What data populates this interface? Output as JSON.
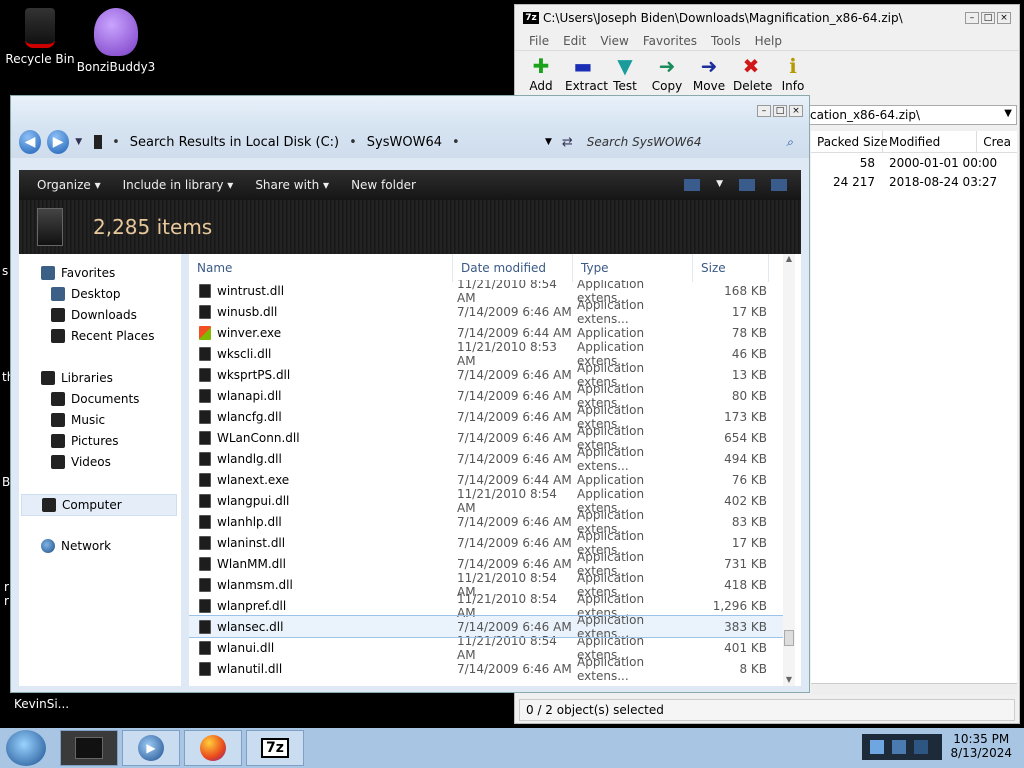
{
  "desktop": {
    "icons": [
      {
        "label": "Recycle Bin"
      },
      {
        "label": "BonziBuddy3"
      },
      {
        "label": "KevinSi..."
      }
    ],
    "edge_fragments": [
      "s",
      "th",
      "B",
      "r",
      "r"
    ]
  },
  "zip": {
    "title": "C:\\Users\\Joseph Biden\\Downloads\\Magnification_x86-64.zip\\",
    "logo": "7z",
    "menu": [
      "File",
      "Edit",
      "View",
      "Favorites",
      "Tools",
      "Help"
    ],
    "tools": [
      {
        "label": "Add",
        "icon": "add-icon",
        "color": "#1aa31a"
      },
      {
        "label": "Extract",
        "icon": "extract-icon",
        "color": "#1a2fb5"
      },
      {
        "label": "Test",
        "icon": "test-icon",
        "color": "#1a9c9c"
      },
      {
        "label": "Copy",
        "icon": "copy-icon",
        "color": "#1a8b5a"
      },
      {
        "label": "Move",
        "icon": "move-icon",
        "color": "#1a2f9c"
      },
      {
        "label": "Delete",
        "icon": "delete-icon",
        "color": "#d01818"
      },
      {
        "label": "Info",
        "icon": "info-icon",
        "color": "#b59b00"
      }
    ],
    "path": "cation_x86-64.zip\\",
    "columns": [
      "Packed Size",
      "Modified",
      "Crea"
    ],
    "rows": [
      {
        "packed": "58",
        "modified": "2000-01-01 00:00"
      },
      {
        "packed": "24 217",
        "modified": "2018-08-24 03:27"
      }
    ],
    "status": "0 / 2 object(s) selected"
  },
  "explorer": {
    "address": [
      "Search Results in Local Disk (C:)",
      "SysWOW64"
    ],
    "search_placeholder": "Search SysWOW64",
    "commands": [
      "Organize ▾",
      "Include in library ▾",
      "Share with ▾",
      "New folder"
    ],
    "item_count": "2,285 items",
    "nav": {
      "favorites": "Favorites",
      "desktop": "Desktop",
      "downloads": "Downloads",
      "recent": "Recent Places",
      "libraries": "Libraries",
      "documents": "Documents",
      "music": "Music",
      "pictures": "Pictures",
      "videos": "Videos",
      "computer": "Computer",
      "network": "Network"
    },
    "columns": {
      "name": "Name",
      "date": "Date modified",
      "type": "Type",
      "size": "Size"
    },
    "files": [
      {
        "name": "wintrust.dll",
        "date": "11/21/2010 8:54 AM",
        "type": "Application extens...",
        "size": "168 KB",
        "icon": "dll"
      },
      {
        "name": "winusb.dll",
        "date": "7/14/2009 6:46 AM",
        "type": "Application extens...",
        "size": "17 KB",
        "icon": "dll"
      },
      {
        "name": "winver.exe",
        "date": "7/14/2009 6:44 AM",
        "type": "Application",
        "size": "78 KB",
        "icon": "win"
      },
      {
        "name": "wkscli.dll",
        "date": "11/21/2010 8:53 AM",
        "type": "Application extens...",
        "size": "46 KB",
        "icon": "dll"
      },
      {
        "name": "wksprtPS.dll",
        "date": "7/14/2009 6:46 AM",
        "type": "Application extens...",
        "size": "13 KB",
        "icon": "dll"
      },
      {
        "name": "wlanapi.dll",
        "date": "7/14/2009 6:46 AM",
        "type": "Application extens...",
        "size": "80 KB",
        "icon": "dll"
      },
      {
        "name": "wlancfg.dll",
        "date": "7/14/2009 6:46 AM",
        "type": "Application extens...",
        "size": "173 KB",
        "icon": "dll"
      },
      {
        "name": "WLanConn.dll",
        "date": "7/14/2009 6:46 AM",
        "type": "Application extens...",
        "size": "654 KB",
        "icon": "dll"
      },
      {
        "name": "wlandlg.dll",
        "date": "7/14/2009 6:46 AM",
        "type": "Application extens...",
        "size": "494 KB",
        "icon": "dll"
      },
      {
        "name": "wlanext.exe",
        "date": "7/14/2009 6:44 AM",
        "type": "Application",
        "size": "76 KB",
        "icon": "exe"
      },
      {
        "name": "wlangpui.dll",
        "date": "11/21/2010 8:54 AM",
        "type": "Application extens...",
        "size": "402 KB",
        "icon": "dll"
      },
      {
        "name": "wlanhlp.dll",
        "date": "7/14/2009 6:46 AM",
        "type": "Application extens...",
        "size": "83 KB",
        "icon": "dll"
      },
      {
        "name": "wlaninst.dll",
        "date": "7/14/2009 6:46 AM",
        "type": "Application extens...",
        "size": "17 KB",
        "icon": "dll"
      },
      {
        "name": "WlanMM.dll",
        "date": "7/14/2009 6:46 AM",
        "type": "Application extens...",
        "size": "731 KB",
        "icon": "dll"
      },
      {
        "name": "wlanmsm.dll",
        "date": "11/21/2010 8:54 AM",
        "type": "Application extens...",
        "size": "418 KB",
        "icon": "dll"
      },
      {
        "name": "wlanpref.dll",
        "date": "11/21/2010 8:54 AM",
        "type": "Application extens...",
        "size": "1,296 KB",
        "icon": "dll"
      },
      {
        "name": "wlansec.dll",
        "date": "7/14/2009 6:46 AM",
        "type": "Application extens...",
        "size": "383 KB",
        "icon": "dll",
        "selected": true
      },
      {
        "name": "wlanui.dll",
        "date": "11/21/2010 8:54 AM",
        "type": "Application extens...",
        "size": "401 KB",
        "icon": "dll"
      },
      {
        "name": "wlanutil.dll",
        "date": "7/14/2009 6:46 AM",
        "type": "Application extens...",
        "size": "8 KB",
        "icon": "dll"
      }
    ]
  },
  "taskbar": {
    "apps": [
      {
        "name": "explorer",
        "label": ""
      },
      {
        "name": "media-player",
        "label": ""
      },
      {
        "name": "firefox",
        "label": ""
      },
      {
        "name": "7zip",
        "label": "7z"
      }
    ],
    "time": "10:35 PM",
    "date": "8/13/2024"
  }
}
